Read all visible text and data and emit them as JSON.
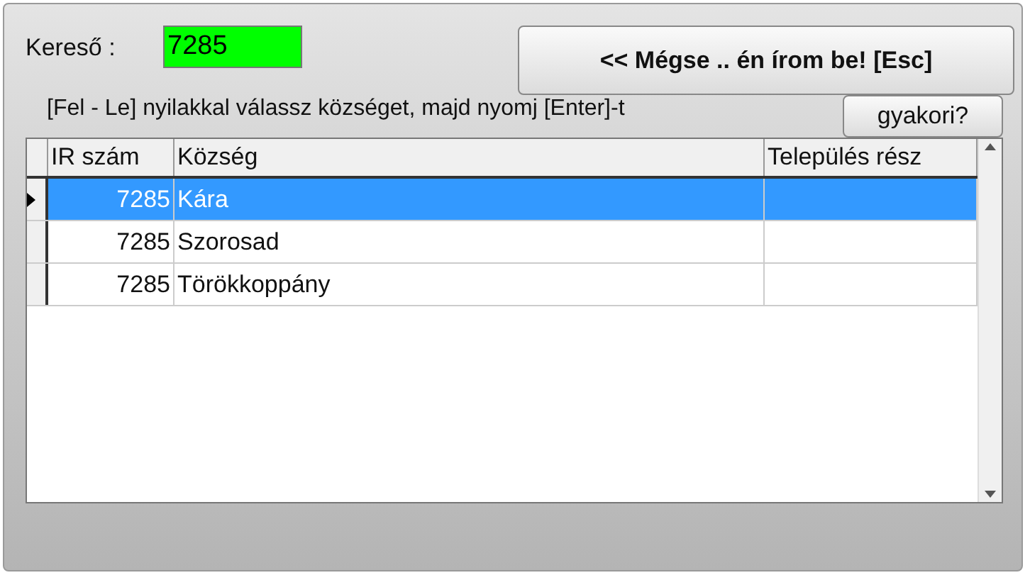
{
  "search": {
    "label": "Kereső :",
    "value": "7285"
  },
  "cancel_button": "<< Mégse .. én írom be! [Esc]",
  "instruction": "[Fel - Le] nyilakkal válassz községet, majd nyomj [Enter]-t",
  "frequent_button": "gyakori?",
  "table": {
    "columns": [
      "IR szám",
      "Község",
      "Település rész"
    ],
    "rows": [
      {
        "ir": "7285",
        "kozseg": "Kára",
        "selected": true
      },
      {
        "ir": "7285",
        "kozseg": "Szorosad",
        "selected": false
      },
      {
        "ir": "7285",
        "kozseg": "Törökkoppány",
        "selected": false
      }
    ]
  }
}
